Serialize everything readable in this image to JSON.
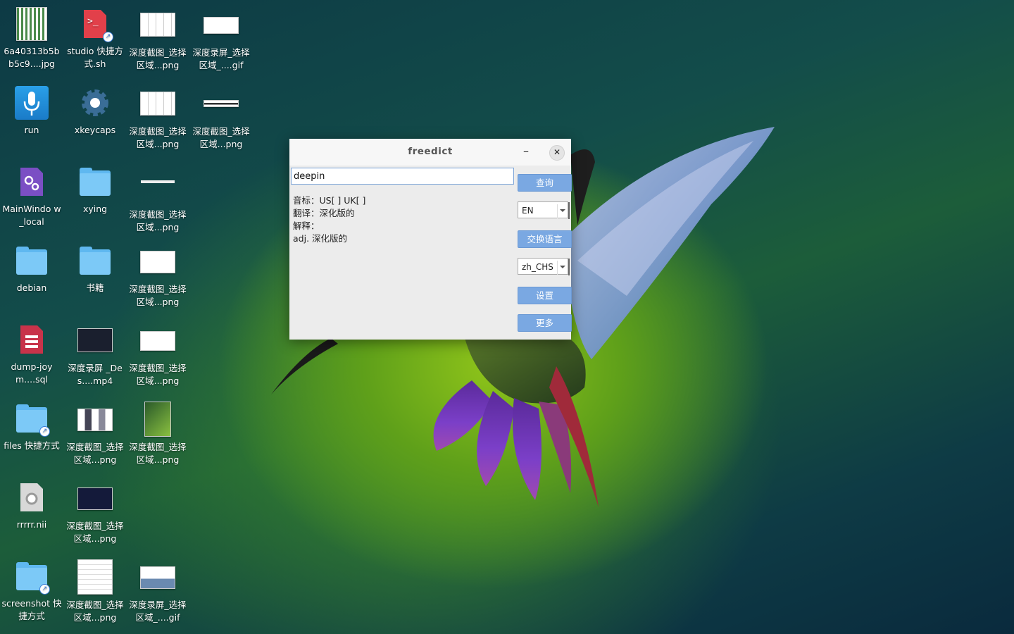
{
  "desktop": {
    "icons": [
      {
        "label": "6a40313b5b b5c9....jpg",
        "icon": "image-thumbnail"
      },
      {
        "label": "studio 快捷方式.sh",
        "icon": "terminal-script-icon"
      },
      {
        "label": "深度截图_选择区域...png",
        "icon": "image-thumbnail"
      },
      {
        "label": "深度录屏_选择区域_....gif",
        "icon": "image-thumbnail"
      },
      {
        "label": "run",
        "icon": "microphone-icon"
      },
      {
        "label": "xkeycaps",
        "icon": "gear-icon"
      },
      {
        "label": "深度截图_选择区域...png",
        "icon": "image-thumbnail"
      },
      {
        "label": "深度截图_选择区域...png",
        "icon": "image-thumbnail"
      },
      {
        "label": "MainWindo w_local",
        "icon": "settings-file-icon"
      },
      {
        "label": "xying",
        "icon": "folder-icon"
      },
      {
        "label": "深度截图_选择区域...png",
        "icon": "image-thumbnail"
      },
      {
        "label": "debian",
        "icon": "folder-icon"
      },
      {
        "label": "书籍",
        "icon": "folder-icon"
      },
      {
        "label": "深度截图_选择区域...png",
        "icon": "image-thumbnail"
      },
      {
        "label": "dump-joym....sql",
        "icon": "database-file-icon"
      },
      {
        "label": "深度录屏 _Des....mp4",
        "icon": "video-thumbnail"
      },
      {
        "label": "深度截图_选择区域...png",
        "icon": "image-thumbnail"
      },
      {
        "label": "files 快捷方式",
        "icon": "folder-shortcut-icon"
      },
      {
        "label": "深度截图_选择区域...png",
        "icon": "image-thumbnail"
      },
      {
        "label": "深度截图_选择区域...png",
        "icon": "image-thumbnail"
      },
      {
        "label": "rrrrr.nii",
        "icon": "config-file-icon"
      },
      {
        "label": "深度截图_选择区域...png",
        "icon": "image-thumbnail"
      },
      {
        "label": "screenshot 快捷方式",
        "icon": "folder-shortcut-icon"
      },
      {
        "label": "深度截图_选择区域...png",
        "icon": "image-thumbnail"
      },
      {
        "label": "深度录屏_选择区域_....gif",
        "icon": "image-thumbnail"
      }
    ]
  },
  "window": {
    "title": "freedict",
    "minimize_glyph": "–",
    "close_glyph": "✕",
    "query_value": "deepin",
    "result": {
      "phonetic": "音标：US[ ] UK[ ]",
      "translation": "翻译：深化版的",
      "explain_label": "解释：",
      "explain": "adj. 深化版的"
    },
    "buttons": {
      "search": "查询",
      "swap": "交换语言",
      "settings": "设置",
      "more": "更多"
    },
    "from_lang": "EN",
    "to_lang": "zh_CHS"
  },
  "colors": {
    "button_blue": "#7aa8e2",
    "folder_blue": "#7cc9f7"
  }
}
